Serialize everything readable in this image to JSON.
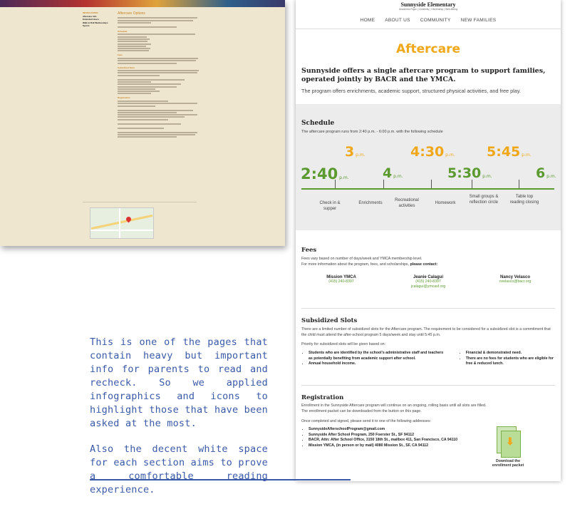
{
  "old_page": {
    "sidebar": {
      "heading": "INFOSCASTER",
      "links": [
        "Aftercare Info",
        "Extended Hours",
        "Walk & Roll Wednesdays",
        "Sports"
      ]
    },
    "title": "Aftercare Options",
    "headings": [
      "Schedule",
      "Fees",
      "Subsidized Slots",
      "Registration"
    ],
    "map_label": "Map"
  },
  "site": {
    "logo": "Sunnyside Elementary",
    "logo_sub": "Academic Rigor | Creativity | Citizenship | Well-Being",
    "nav": [
      "HOME",
      "ABOUT US",
      "COMMUNITY",
      "NEW FAMILIES"
    ]
  },
  "page": {
    "title": "Aftercare",
    "intro": "Sunnyside offers a single aftercare program to support families, operated jointly by BACR and the YMCA.",
    "intro_sub": "The program offers enrichments, academic support, structured physical activities, and free play."
  },
  "schedule": {
    "heading": "Schedule",
    "sub": "The aftercare program runs from 2:40 p.m. - 6:00 p.m. with the following schedule",
    "times": [
      {
        "time": "2:40",
        "suffix": "p.m.",
        "color": "#5b9a2e"
      },
      {
        "time": "3",
        "suffix": "p.m.",
        "color": "#f0a81a"
      },
      {
        "time": "4",
        "suffix": "p.m.",
        "color": "#5b9a2e"
      },
      {
        "time": "4:30",
        "suffix": "p.m.",
        "color": "#f0a81a"
      },
      {
        "time": "5:30",
        "suffix": "p.m.",
        "color": "#5b9a2e"
      },
      {
        "time": "5:45",
        "suffix": "p.m.",
        "color": "#f0a81a"
      },
      {
        "time": "6",
        "suffix": "p.m.",
        "color": "#5b9a2e"
      }
    ],
    "activities": [
      "Check in & supper",
      "Enrichments",
      "Recreational activities",
      "Homework",
      "Small groups & reflection circle",
      "Table top reading closing"
    ]
  },
  "fees": {
    "heading": "Fees",
    "line1": "Fees vary based on number of days/week and YMCA membership level.",
    "line2_pre": "For more information about the program, fees, and scholarships, ",
    "line2_bold": "please contact:",
    "contacts": [
      {
        "name": "Mission YMCA",
        "phone": "(415) 240-8397",
        "email": ""
      },
      {
        "name": "Jeanie Calagui",
        "phone": "(415) 240-8397",
        "email": "jcalagui@ymcasf.org"
      },
      {
        "name": "Nancy Velasco",
        "phone": "",
        "email": "nvelasco@bacr.org"
      }
    ]
  },
  "subsidized": {
    "heading": "Subsidized Slots",
    "p1": "There are a limited number of subsidized slots for the Aftercare program. The requirement to be considered for a subsidized slot is a commitment that the child must attend the after-school program 5 days/week and stay until 5:45 p.m.",
    "p2": "Priority for subsidized slots will be given based on:",
    "left": [
      "Students who are identified by the school's administrative staff and teachers as potentially benefiting from academic support after school.",
      "Annual household income."
    ],
    "right": [
      "Financial & demonstrated need.",
      "There are no fees for students who are eligible for free & reduced lunch."
    ]
  },
  "registration": {
    "heading": "Registration",
    "p1": "Enrollment in the Sunnyside Aftercare program will continue on an ongoing, rolling basis until all slots are filled.",
    "p2": "The enrollment packet can be downloaded from the button on this page.",
    "p3": "Once completed and signed, please send it to one of the following addresses:",
    "addresses": [
      "SunnysideAfterschoolProgram@gmail.com",
      "Sunnyside After School Program, 250 Foerster St., SF 94112",
      "BACR, Attn: After School Office, 3150 18th St., mailbox 411, San Francisco, CA 94110",
      "Mission YMCA, (in person or by mail) 4080 Mission St., SF, CA 94112"
    ],
    "download_label": "Download the enrollment packet"
  },
  "caption": {
    "p1": "This is one of the pages that contain heavy but important info for parents to read and recheck. So we applied infographics and icons to highlight those that have been asked at the most.",
    "p2": "Also the decent white space for each section aims to prove a comfortable reading experience."
  }
}
